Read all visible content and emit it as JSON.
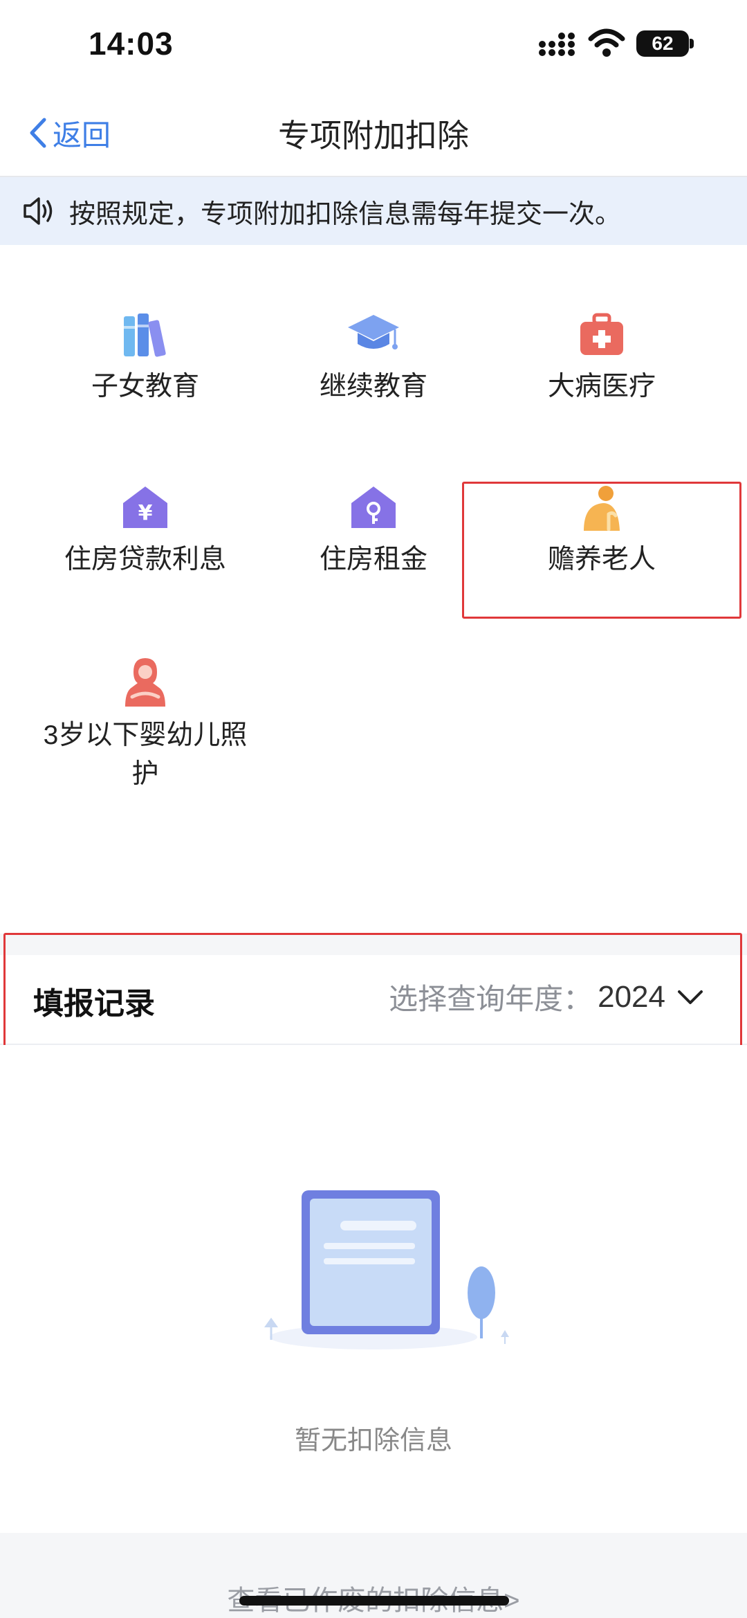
{
  "status": {
    "time": "14:03",
    "battery": "62"
  },
  "nav": {
    "back_label": "返回",
    "title": "专项附加扣除"
  },
  "notice": {
    "text": "按照规定，专项附加扣除信息需每年提交一次。"
  },
  "items": [
    {
      "label": "子女教育",
      "icon": "books-icon"
    },
    {
      "label": "继续教育",
      "icon": "graduation-cap-icon"
    },
    {
      "label": "大病医疗",
      "icon": "medical-kit-icon"
    },
    {
      "label": "住房贷款利息",
      "icon": "house-yuan-icon"
    },
    {
      "label": "住房租金",
      "icon": "house-key-icon"
    },
    {
      "label": "赡养老人",
      "icon": "elderly-person-icon"
    },
    {
      "label": "3岁以下婴幼儿照护",
      "icon": "mother-baby-icon"
    }
  ],
  "records": {
    "title": "填报记录",
    "year_label": "选择查询年度：",
    "year": "2024"
  },
  "empty": {
    "text": "暂无扣除信息"
  },
  "footer": {
    "link": "查看已作废的扣除信息>"
  },
  "colors": {
    "accent": "#3f7fe6",
    "highlight": "#e0383a",
    "notice_bg": "#e9f0fb"
  }
}
